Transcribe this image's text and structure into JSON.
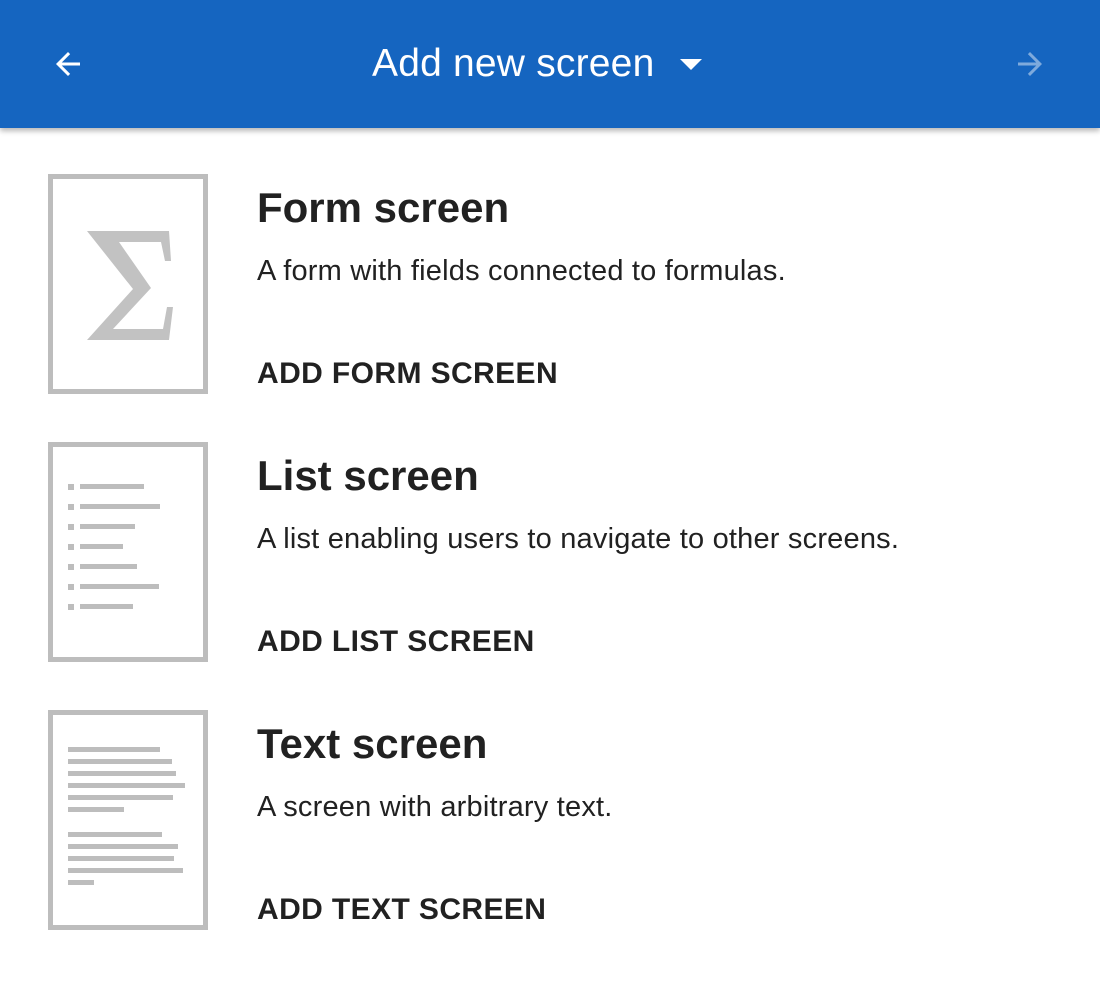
{
  "app_bar": {
    "title": "Add new screen",
    "back_icon": "arrow-left-icon",
    "next_icon": "arrow-right-icon",
    "dropdown_icon": "caret-down-icon",
    "background_color": "#1565c0",
    "next_disabled": true
  },
  "cards": [
    {
      "title": "Form screen",
      "description": "A form with fields connected to formulas.",
      "action_label": "ADD FORM SCREEN",
      "thumbnail_icon": "sigma-icon",
      "thumbnail_glyph": "Σ"
    },
    {
      "title": "List screen",
      "description": "A list enabling users to navigate to other screens.",
      "action_label": "ADD LIST SCREEN",
      "thumbnail_icon": "list-icon"
    },
    {
      "title": "Text screen",
      "description": "A screen with arbitrary text.",
      "action_label": "ADD TEXT SCREEN",
      "thumbnail_icon": "text-document-icon"
    }
  ]
}
